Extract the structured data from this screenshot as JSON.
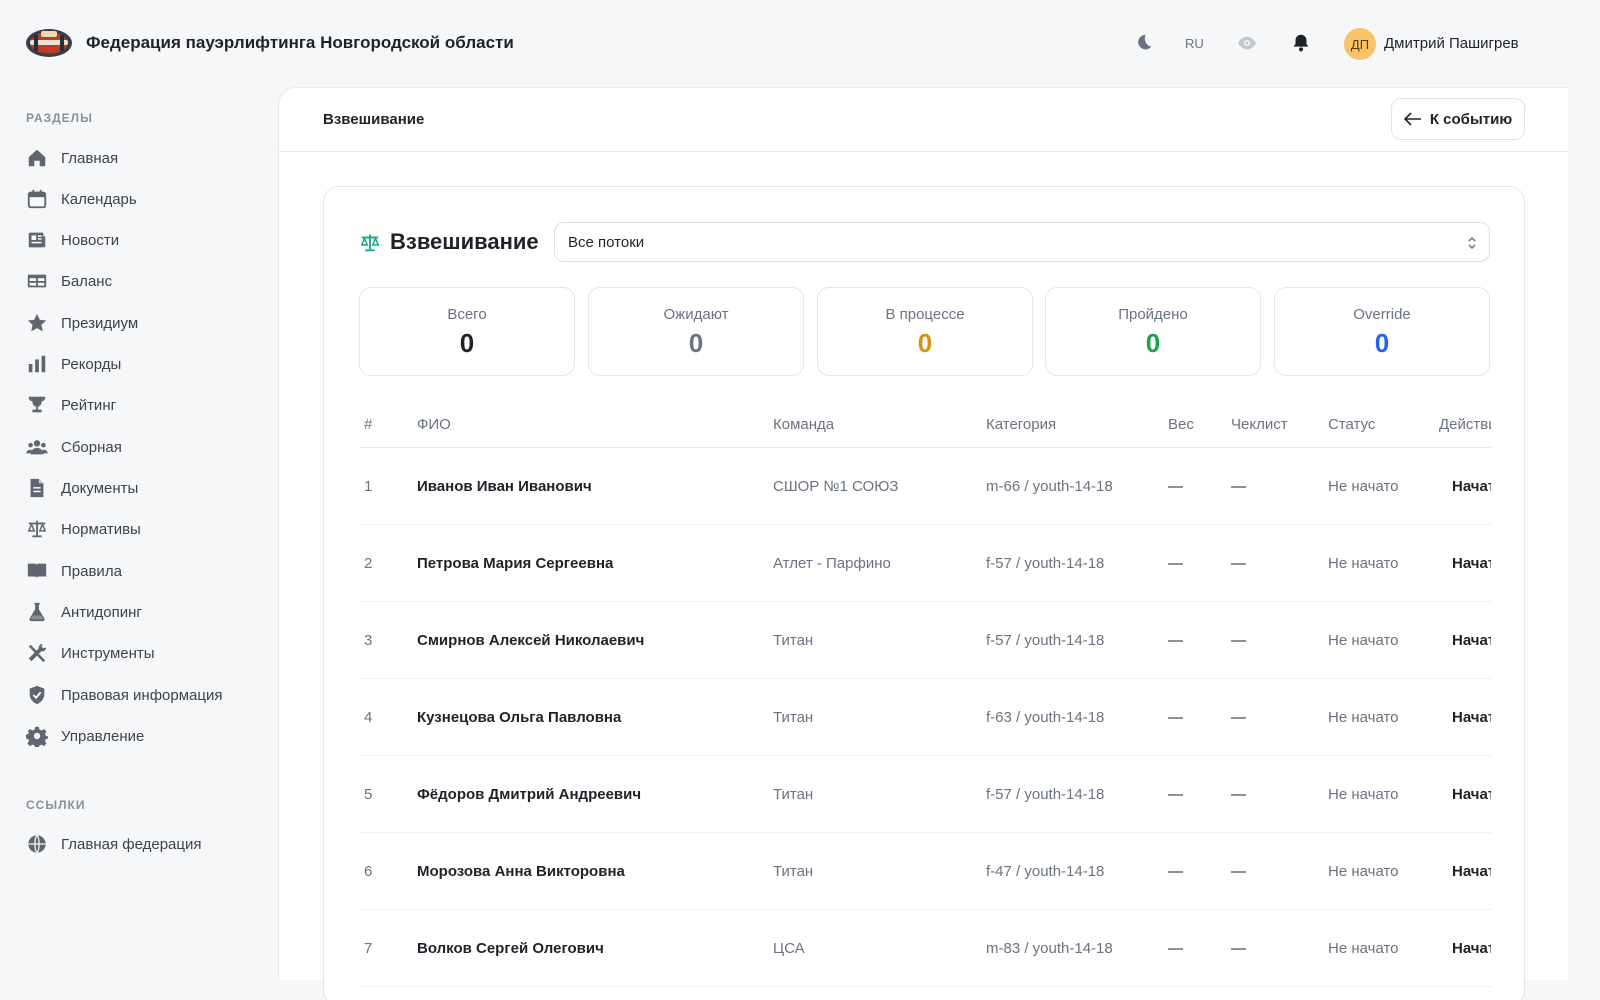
{
  "header": {
    "org_title": "Федерация пауэрлифтинга Новгородской области",
    "lang": "RU",
    "avatar_initials": "ДП",
    "user_name": "Дмитрий Пашигрев",
    "icons": [
      "moon-icon",
      "eye-icon",
      "bell-icon"
    ]
  },
  "sidebar": {
    "sections_label": "РАЗДЕЛЫ",
    "items": [
      {
        "label": "Главная",
        "icon": "home-icon"
      },
      {
        "label": "Календарь",
        "icon": "calendar-icon"
      },
      {
        "label": "Новости",
        "icon": "newspaper-icon"
      },
      {
        "label": "Баланс",
        "icon": "table-icon"
      },
      {
        "label": "Президиум",
        "icon": "star-icon"
      },
      {
        "label": "Рекорды",
        "icon": "bar-chart-icon"
      },
      {
        "label": "Рейтинг",
        "icon": "trophy-icon"
      },
      {
        "label": "Сборная",
        "icon": "users-icon"
      },
      {
        "label": "Документы",
        "icon": "document-icon"
      },
      {
        "label": "Нормативы",
        "icon": "scale-icon"
      },
      {
        "label": "Правила",
        "icon": "book-icon"
      },
      {
        "label": "Антидопинг",
        "icon": "flask-icon"
      },
      {
        "label": "Инструменты",
        "icon": "tools-icon"
      },
      {
        "label": "Правовая информация",
        "icon": "shield-check-icon"
      },
      {
        "label": "Управление",
        "icon": "gear-icon"
      }
    ],
    "links_label": "ССЫЛКИ",
    "links": [
      {
        "label": "Главная федерация",
        "icon": "globe-icon"
      }
    ]
  },
  "page": {
    "breadcrumb": "Взвешивание",
    "back_label": "К событию"
  },
  "card": {
    "title": "Взвешивание",
    "stream_select": "Все потоки",
    "stats": [
      {
        "label": "Всего",
        "value": "0",
        "color": "#1f2329"
      },
      {
        "label": "Ожидают",
        "value": "0",
        "color": "#6b7280"
      },
      {
        "label": "В процессе",
        "value": "0",
        "color": "#d4930d"
      },
      {
        "label": "Пройдено",
        "value": "0",
        "color": "#16a34a"
      },
      {
        "label": "Override",
        "value": "0",
        "color": "#2563eb"
      }
    ]
  },
  "table": {
    "columns": [
      "#",
      "ФИО",
      "Команда",
      "Категория",
      "Вес",
      "Чеклист",
      "Статус",
      "Действия"
    ],
    "rows": [
      {
        "num": "1",
        "name": "Иванов Иван Иванович",
        "team": "СШОР №1 СОЮЗ",
        "category": "m-66 / youth-14-18",
        "weight": "—",
        "checklist": "—",
        "status": "Не начато",
        "action": "Начать"
      },
      {
        "num": "2",
        "name": "Петрова Мария Сергеевна",
        "team": "Атлет - Парфино",
        "category": "f-57 / youth-14-18",
        "weight": "—",
        "checklist": "—",
        "status": "Не начато",
        "action": "Начать"
      },
      {
        "num": "3",
        "name": "Смирнов Алексей Николаевич",
        "team": "Титан",
        "category": "f-57 / youth-14-18",
        "weight": "—",
        "checklist": "—",
        "status": "Не начато",
        "action": "Начать"
      },
      {
        "num": "4",
        "name": "Кузнецова Ольга Павловна",
        "team": "Титан",
        "category": "f-63 / youth-14-18",
        "weight": "—",
        "checklist": "—",
        "status": "Не начато",
        "action": "Начать"
      },
      {
        "num": "5",
        "name": "Фёдоров Дмитрий Андреевич",
        "team": "Титан",
        "category": "f-57 / youth-14-18",
        "weight": "—",
        "checklist": "—",
        "status": "Не начато",
        "action": "Начать"
      },
      {
        "num": "6",
        "name": "Морозова Анна Викторовна",
        "team": "Титан",
        "category": "f-47 / youth-14-18",
        "weight": "—",
        "checklist": "—",
        "status": "Не начато",
        "action": "Начать"
      },
      {
        "num": "7",
        "name": "Волков Сергей Олегович",
        "team": "ЦСА",
        "category": "m-83 / youth-14-18",
        "weight": "—",
        "checklist": "—",
        "status": "Не начато",
        "action": "Начать"
      }
    ]
  }
}
